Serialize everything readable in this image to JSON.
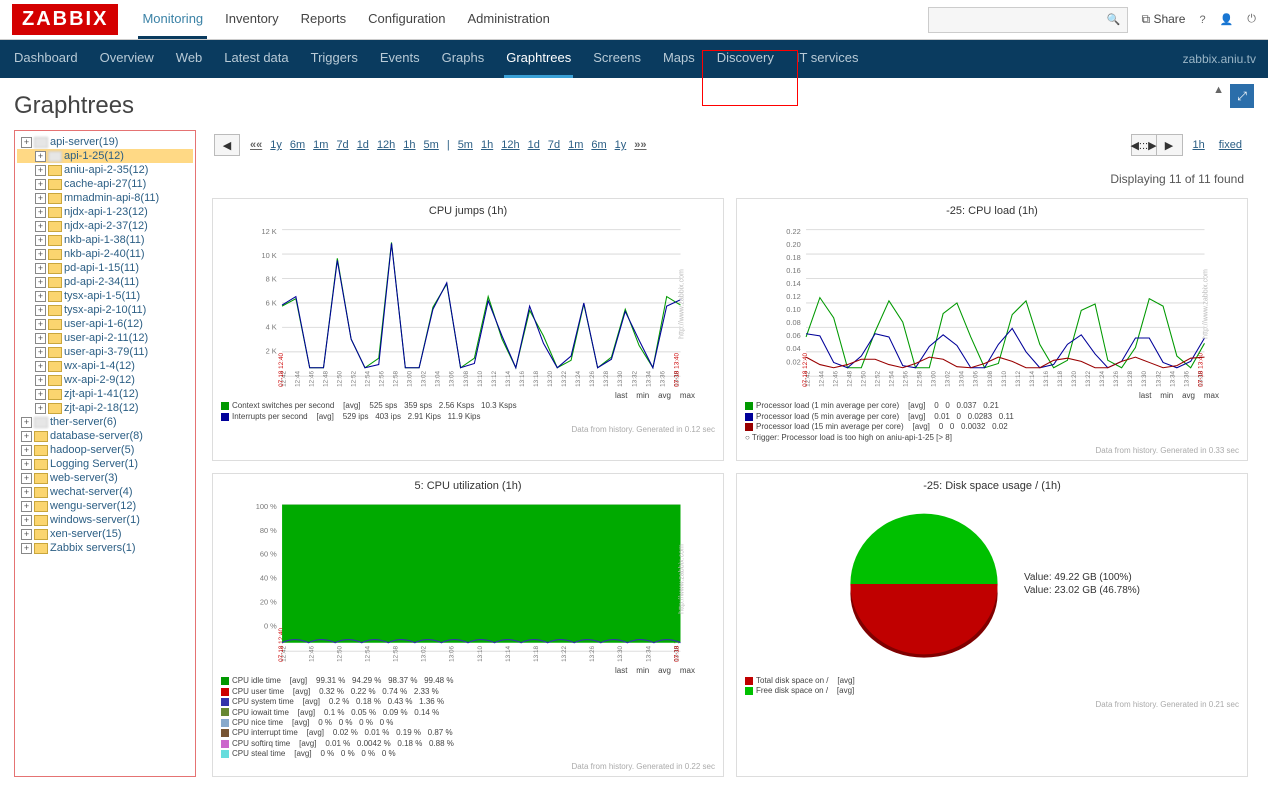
{
  "brand": "ZABBIX",
  "mainnav": [
    "Monitoring",
    "Inventory",
    "Reports",
    "Configuration",
    "Administration"
  ],
  "mainnav_active": 0,
  "share": "Share",
  "subtabs": [
    "Dashboard",
    "Overview",
    "Web",
    "Latest data",
    "Triggers",
    "Events",
    "Graphs",
    "Graphtrees",
    "Screens",
    "Maps",
    "Discovery",
    "IT services"
  ],
  "subtabs_active": 7,
  "server_label": "zabbix.aniu.tv",
  "page_title": "Graphtrees",
  "tree": {
    "root": [
      {
        "label": "api-server(19)",
        "blurred": true,
        "selected": false,
        "level": 0
      },
      {
        "label": "api-1-25(12)",
        "blurred": true,
        "selected": true,
        "level": 1
      },
      {
        "label": "aniu-api-2-35(12)",
        "level": 1
      },
      {
        "label": "cache-api-27(11)",
        "level": 1
      },
      {
        "label": "mmadmin-api-8(11)",
        "level": 1
      },
      {
        "label": "njdx-api-1-23(12)",
        "level": 1
      },
      {
        "label": "njdx-api-2-37(12)",
        "level": 1
      },
      {
        "label": "nkb-api-1-38(11)",
        "level": 1
      },
      {
        "label": "nkb-api-2-40(11)",
        "level": 1
      },
      {
        "label": "pd-api-1-15(11)",
        "level": 1
      },
      {
        "label": "pd-api-2-34(11)",
        "level": 1
      },
      {
        "label": "tysx-api-1-5(11)",
        "level": 1
      },
      {
        "label": "tysx-api-2-10(11)",
        "level": 1
      },
      {
        "label": "user-api-1-6(12)",
        "level": 1
      },
      {
        "label": "user-api-2-11(12)",
        "level": 1
      },
      {
        "label": "user-api-3-79(11)",
        "level": 1
      },
      {
        "label": "wx-api-1-4(12)",
        "level": 1
      },
      {
        "label": "wx-api-2-9(12)",
        "level": 1
      },
      {
        "label": "zjt-api-1-41(12)",
        "level": 1
      },
      {
        "label": "zjt-api-2-18(12)",
        "level": 1
      },
      {
        "label": "ther-server(6)",
        "blurred": true,
        "level": 0
      },
      {
        "label": "database-server(8)",
        "level": 0
      },
      {
        "label": "hadoop-server(5)",
        "level": 0
      },
      {
        "label": "Logging Server(1)",
        "level": 0
      },
      {
        "label": "web-server(3)",
        "level": 0
      },
      {
        "label": "wechat-server(4)",
        "level": 0
      },
      {
        "label": "wengu-server(12)",
        "level": 0
      },
      {
        "label": "windows-server(1)",
        "level": 0
      },
      {
        "label": "xen-server(15)",
        "level": 0
      },
      {
        "label": "Zabbix servers(1)",
        "level": 0
      }
    ]
  },
  "ranges_before": [
    "1y",
    "6m",
    "1m",
    "7d",
    "1d",
    "12h",
    "1h",
    "5m"
  ],
  "ranges_after": [
    "5m",
    "1h",
    "12h",
    "1d",
    "7d",
    "1m",
    "6m",
    "1y"
  ],
  "range_selected": "1h",
  "range_mode": "fixed",
  "results_text": "Displaying 11 of 11 found",
  "chart_data": [
    {
      "type": "line",
      "title": "CPU jumps (1h)",
      "x_start": "07-18 12:40",
      "x_end": "07-18 13:40",
      "categories": [
        "12:42",
        "12:44",
        "12:46",
        "12:48",
        "12:50",
        "12:52",
        "12:54",
        "12:56",
        "12:58",
        "13:00",
        "13:02",
        "13:04",
        "13:06",
        "13:08",
        "13:10",
        "13:12",
        "13:14",
        "13:16",
        "13:18",
        "13:20",
        "13:22",
        "13:24",
        "13:26",
        "13:28",
        "13:30",
        "13:32",
        "13:34",
        "13:36",
        "13:38"
      ],
      "ylim": [
        0,
        12000
      ],
      "ylabel": "",
      "y_ticks": [
        "2 K",
        "4 K",
        "6 K",
        "8 K",
        "10 K",
        "12 K"
      ],
      "series": [
        {
          "name": "Context switches per second",
          "color": "#009900",
          "stat": "[avg]",
          "last": "525 sps",
          "min": "359 sps",
          "avg": "2.56 Ksps",
          "max": "10.3 Ksps"
        },
        {
          "name": "Interrupts per second",
          "color": "#000099",
          "stat": "[avg]",
          "last": "529 ips",
          "min": "403 ips",
          "avg": "2.91 Kips",
          "max": "11.9 Kips"
        }
      ],
      "gen": "Data from history. Generated in 0.12 sec"
    },
    {
      "type": "line",
      "title": "-25: CPU load (1h)",
      "x_start": "07-18 12:40",
      "x_end": "07-18 13:40",
      "categories": [
        "12:42",
        "12:44",
        "12:46",
        "12:48",
        "12:50",
        "12:52",
        "12:54",
        "12:56",
        "12:58",
        "13:00",
        "13:02",
        "13:04",
        "13:06",
        "13:08",
        "13:10",
        "13:12",
        "13:14",
        "13:16",
        "13:18",
        "13:20",
        "13:22",
        "13:24",
        "13:26",
        "13:28",
        "13:30",
        "13:32",
        "13:34",
        "13:36",
        "13:38"
      ],
      "ylim": [
        0,
        0.22
      ],
      "y_ticks": [
        "0.02",
        "0.04",
        "0.06",
        "0.08",
        "0.10",
        "0.12",
        "0.14",
        "0.16",
        "0.18",
        "0.20",
        "0.22"
      ],
      "series": [
        {
          "name": "Processor load (1 min average per core)",
          "color": "#009900",
          "stat": "[avg]",
          "last": "0",
          "min": "0",
          "avg": "0.037",
          "max": "0.21"
        },
        {
          "name": "Processor load (5 min average per core)",
          "color": "#000099",
          "stat": "[avg]",
          "last": "0.01",
          "min": "0",
          "avg": "0.0283",
          "max": "0.11"
        },
        {
          "name": "Processor load (15 min average per core)",
          "color": "#990000",
          "stat": "[avg]",
          "last": "0",
          "min": "0",
          "avg": "0.0032",
          "max": "0.02"
        }
      ],
      "trigger": "Trigger: Processor load is too high on aniu-api-1-25    [> 8]",
      "gen": "Data from history. Generated in 0.33 sec"
    },
    {
      "type": "area",
      "title": "5: CPU utilization (1h)",
      "x_start": "07-18 12:40",
      "x_end": "07-18 13:40",
      "categories": [
        "12:42",
        "12:46",
        "12:50",
        "12:54",
        "12:58",
        "13:02",
        "13:06",
        "13:10",
        "13:14",
        "13:18",
        "13:22",
        "13:26",
        "13:30",
        "13:34",
        "13:38"
      ],
      "ylim": [
        0,
        100
      ],
      "y_ticks": [
        "0 %",
        "20 %",
        "40 %",
        "60 %",
        "80 %",
        "100 %"
      ],
      "series": [
        {
          "name": "CPU idle time",
          "color": "#009900",
          "stat": "[avg]",
          "last": "99.31 %",
          "min": "94.29 %",
          "avg": "98.37 %",
          "max": "99.48 %"
        },
        {
          "name": "CPU user time",
          "color": "#cc0000",
          "stat": "[avg]",
          "last": "0.32 %",
          "min": "0.22 %",
          "avg": "0.74 %",
          "max": "2.33 %"
        },
        {
          "name": "CPU system time",
          "color": "#3333aa",
          "stat": "[avg]",
          "last": "0.2 %",
          "min": "0.18 %",
          "avg": "0.43 %",
          "max": "1.36 %"
        },
        {
          "name": "CPU iowait time",
          "color": "#668833",
          "stat": "[avg]",
          "last": "0.1 %",
          "min": "0.05 %",
          "avg": "0.09 %",
          "max": "0.14 %"
        },
        {
          "name": "CPU nice time",
          "color": "#88aacc",
          "stat": "[avg]",
          "last": "0 %",
          "min": "0 %",
          "avg": "0 %",
          "max": "0 %"
        },
        {
          "name": "CPU interrupt time",
          "color": "#775533",
          "stat": "[avg]",
          "last": "0.02 %",
          "min": "0.01 %",
          "avg": "0.19 %",
          "max": "0.87 %"
        },
        {
          "name": "CPU softirq time",
          "color": "#cc66cc",
          "stat": "[avg]",
          "last": "0.01 %",
          "min": "0.0042 %",
          "avg": "0.18 %",
          "max": "0.88 %"
        },
        {
          "name": "CPU steal time",
          "color": "#66dddd",
          "stat": "[avg]",
          "last": "0 %",
          "min": "0 %",
          "avg": "0 %",
          "max": "0 %"
        }
      ],
      "gen": "Data from history. Generated in 0.22 sec"
    },
    {
      "type": "pie",
      "title": "-25: Disk space usage / (1h)",
      "values": [
        {
          "label": "Value: 49.22 GB (100%)",
          "color": "#c00000",
          "pct": 100
        },
        {
          "label": "Value: 23.02 GB (46.78%)",
          "color": "#00c000",
          "pct": 46.78
        }
      ],
      "series": [
        {
          "name": "Total disk space on /",
          "color": "#c00000",
          "stat": "[avg]"
        },
        {
          "name": "Free disk space on /",
          "color": "#00c000",
          "stat": "[avg]"
        }
      ],
      "gen": "Data from history. Generated in 0.21 sec"
    }
  ]
}
